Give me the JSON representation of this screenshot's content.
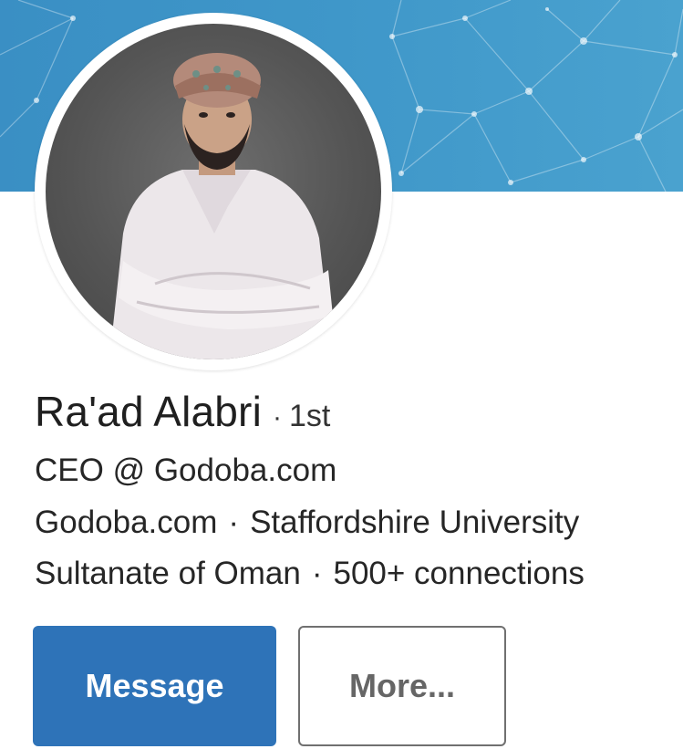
{
  "profile": {
    "name": "Ra'ad Alabri",
    "degree_separator": "·",
    "degree": "1st",
    "headline": "CEO @ Godoba.com",
    "company": "Godoba.com",
    "school": "Staffordshire University",
    "location": "Sultanate of Oman",
    "connections": "500+ connections",
    "separator": "·"
  },
  "actions": {
    "message_label": "Message",
    "more_label": "More..."
  },
  "colors": {
    "banner": "#3f97c9",
    "primary_button": "#2e73b8",
    "secondary_border": "#707070"
  },
  "icons": {
    "banner_pattern": "network-mesh-pattern",
    "avatar": "profile-photo"
  }
}
